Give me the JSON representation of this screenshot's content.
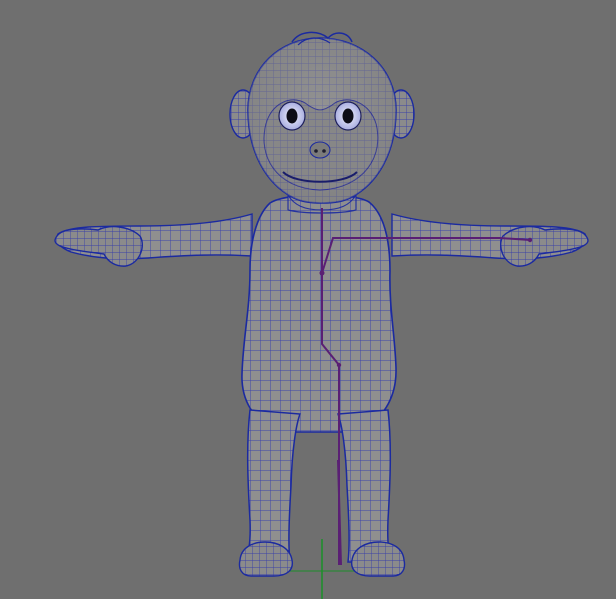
{
  "viewport": {
    "background_color": "#6f6f6f",
    "wire_color": "#2b2fa4",
    "shade_color": "#8e8e8e",
    "skeleton_color": "#5a1f74",
    "grid_axis_color": "#1f8f2c"
  },
  "icons": {
    "model": "monkey-mesh-icon",
    "axis": "world-axis-icon"
  }
}
